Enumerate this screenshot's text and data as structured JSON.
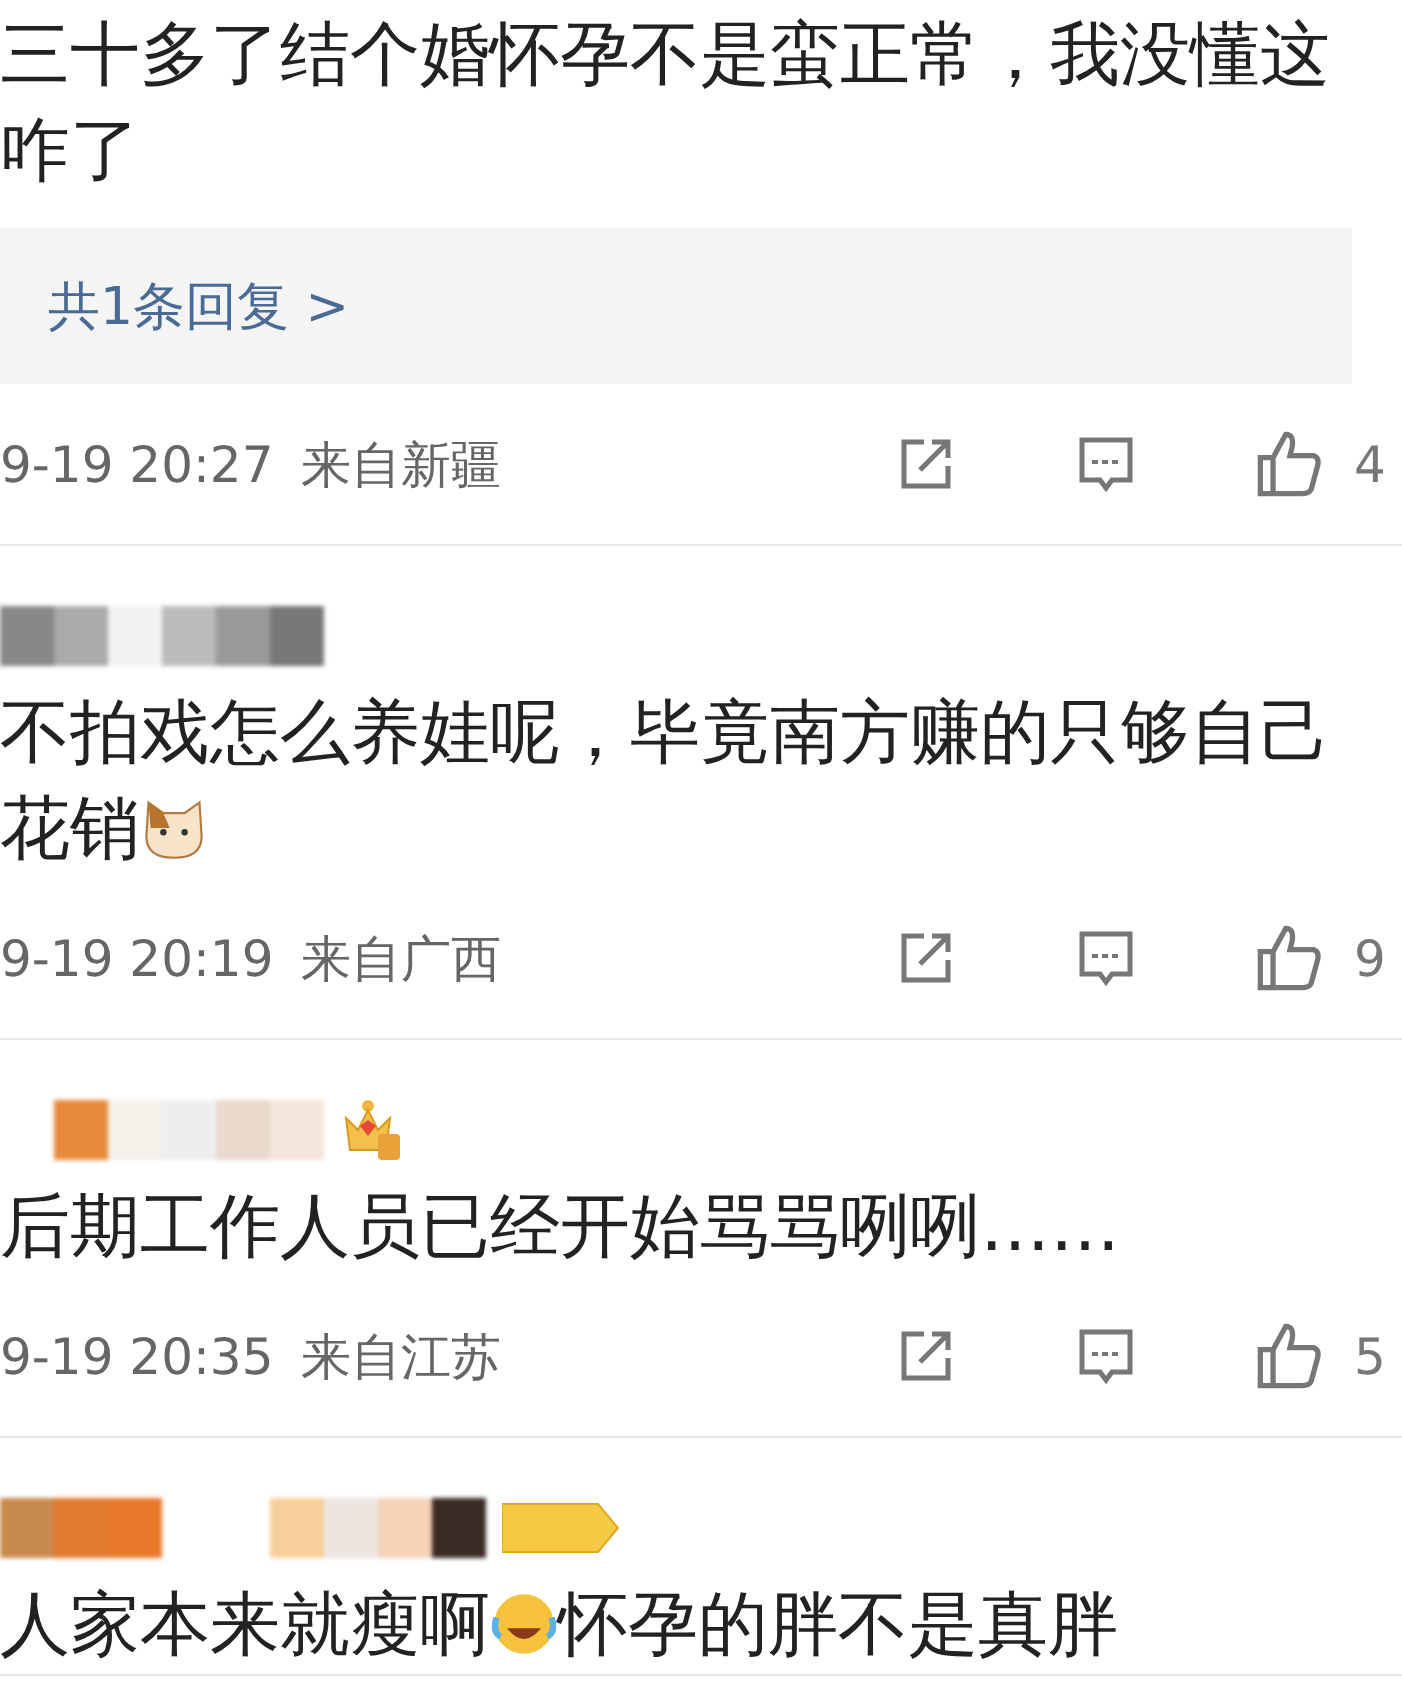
{
  "comments": [
    {
      "segments": [
        {
          "kind": "text",
          "text": "三十多了结个婚怀孕不是蛮正常，我没懂这咋了"
        }
      ],
      "reply_link": "共1条回复 >",
      "time": "9-19 20:27",
      "location": "来自新疆",
      "likes": "4"
    },
    {
      "user": [
        {
          "kind": "grey"
        }
      ],
      "segments": [
        {
          "kind": "text",
          "text": "不拍戏怎么养娃呢，毕竟南方赚的只够自己花销"
        },
        {
          "kind": "cat"
        }
      ],
      "time": "9-19 20:19",
      "location": "来自广西",
      "likes": "9"
    },
    {
      "user": [
        {
          "kind": "pale"
        },
        {
          "kind": "crown"
        }
      ],
      "segments": [
        {
          "kind": "text",
          "text": "后期工作人员已经开始骂骂咧咧……"
        }
      ],
      "time": "9-19 20:35",
      "location": "来自江苏",
      "likes": "5"
    },
    {
      "user": [
        {
          "kind": "warm"
        },
        {
          "kind": "vip"
        }
      ],
      "segments": [
        {
          "kind": "text",
          "text": "人家本来就瘦啊"
        },
        {
          "kind": "laugh"
        },
        {
          "kind": "text",
          "text": "怀孕的胖不是真胖"
        }
      ]
    }
  ]
}
